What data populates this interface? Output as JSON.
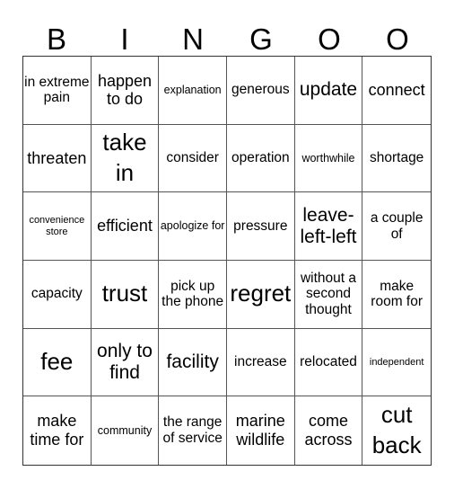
{
  "header": {
    "letters": [
      "B",
      "I",
      "N",
      "G",
      "O",
      "O"
    ]
  },
  "board": {
    "rows": [
      [
        {
          "text": "in extreme pain",
          "size": "m"
        },
        {
          "text": "happen to do",
          "size": "l"
        },
        {
          "text": "explanation",
          "size": "s"
        },
        {
          "text": "generous",
          "size": "m"
        },
        {
          "text": "update",
          "size": "xl"
        },
        {
          "text": "connect",
          "size": "l"
        }
      ],
      [
        {
          "text": "threaten",
          "size": "l"
        },
        {
          "text": "take in",
          "size": "xxl"
        },
        {
          "text": "consider",
          "size": "m"
        },
        {
          "text": "operation",
          "size": "m"
        },
        {
          "text": "worthwhile",
          "size": "s"
        },
        {
          "text": "shortage",
          "size": "m"
        }
      ],
      [
        {
          "text": "convenience store",
          "size": "xs"
        },
        {
          "text": "efficient",
          "size": "l"
        },
        {
          "text": "apologize for",
          "size": "s"
        },
        {
          "text": "pressure",
          "size": "m"
        },
        {
          "text": "leave-left-left",
          "size": "xl"
        },
        {
          "text": "a couple of",
          "size": "m"
        }
      ],
      [
        {
          "text": "capacity",
          "size": "m"
        },
        {
          "text": "trust",
          "size": "xxl"
        },
        {
          "text": "pick up the phone",
          "size": "m"
        },
        {
          "text": "regret",
          "size": "xxl"
        },
        {
          "text": "without a second thought",
          "size": "m"
        },
        {
          "text": "make room for",
          "size": "m"
        }
      ],
      [
        {
          "text": "fee",
          "size": "xxl"
        },
        {
          "text": "only to find",
          "size": "xl"
        },
        {
          "text": "facility",
          "size": "xl"
        },
        {
          "text": "increase",
          "size": "m"
        },
        {
          "text": "relocated",
          "size": "m"
        },
        {
          "text": "independent",
          "size": "xs"
        }
      ],
      [
        {
          "text": "make time for",
          "size": "l"
        },
        {
          "text": "community",
          "size": "s"
        },
        {
          "text": "the range of service",
          "size": "m"
        },
        {
          "text": "marine wildlife",
          "size": "l"
        },
        {
          "text": "come across",
          "size": "l"
        },
        {
          "text": "cut back",
          "size": "xxl"
        }
      ]
    ]
  }
}
